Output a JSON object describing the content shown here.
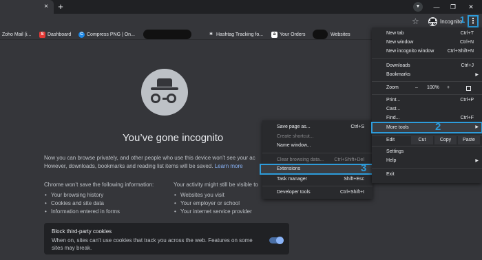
{
  "tabstrip": {
    "close_glyph": "×",
    "new_tab_glyph": "+",
    "tab_search_glyph": "▼",
    "minimize_glyph": "—",
    "restore_glyph": "❐",
    "close_window_glyph": "✕"
  },
  "toolbar": {
    "star_glyph": "☆",
    "profile_label": "Incognito",
    "menu_glyph": "⋮",
    "marker": "1"
  },
  "bookmarks": [
    {
      "label": "Zoho Mail (i...",
      "icon": "",
      "color": "#35363a"
    },
    {
      "label": "Dashboard",
      "icon": "S",
      "color": "#e53935"
    },
    {
      "label": "Compress PNG | On...",
      "icon": "C",
      "color": "#1e88e5"
    },
    {
      "label": "Hashtag Tracking fo...",
      "icon": "✱",
      "color": "#35363a"
    },
    {
      "label": "Your Orders",
      "icon": "a",
      "color": "#35363a"
    },
    {
      "label": "Websites",
      "icon": "",
      "color": "#35363a"
    }
  ],
  "page": {
    "title": "You’ve gone incognito",
    "para1": "Now you can browse privately, and other people who use this device won’t see your ac",
    "para2": "However, downloads, bookmarks and reading list items will be saved.",
    "learn_more": "Learn more",
    "col1_head": "Chrome won’t save the following information:",
    "col1_items": [
      "Your browsing history",
      "Cookies and site data",
      "Information entered in forms"
    ],
    "col2_head": "Your activity might still be visible to",
    "col2_items": [
      "Websites you visit",
      "Your employer or school",
      "Your internet service provider"
    ],
    "cookie_title": "Block third-party cookies",
    "cookie_desc": "When on, sites can’t use cookies that track you across the web. Features on some sites may break."
  },
  "main_menu": {
    "new_tab": {
      "label": "New tab",
      "shortcut": "Ctrl+T"
    },
    "new_window": {
      "label": "New window",
      "shortcut": "Ctrl+N"
    },
    "new_incognito": {
      "label": "New incognito window",
      "shortcut": "Ctrl+Shift+N"
    },
    "downloads": {
      "label": "Downloads",
      "shortcut": "Ctrl+J"
    },
    "bookmarks": {
      "label": "Bookmarks",
      "arrow": "▶"
    },
    "zoom": {
      "label": "Zoom",
      "minus": "–",
      "value": "100%",
      "plus": "+"
    },
    "print": {
      "label": "Print...",
      "shortcut": "Ctrl+P"
    },
    "cast": {
      "label": "Cast..."
    },
    "find": {
      "label": "Find...",
      "shortcut": "Ctrl+F"
    },
    "more_tools": {
      "label": "More tools",
      "arrow": "▶",
      "marker": "2"
    },
    "edit": {
      "label": "Edit",
      "cut": "Cut",
      "copy": "Copy",
      "paste": "Paste"
    },
    "settings": {
      "label": "Settings"
    },
    "help": {
      "label": "Help",
      "arrow": "▶"
    },
    "exit": {
      "label": "Exit"
    }
  },
  "submenu": {
    "save_page": {
      "label": "Save page as...",
      "shortcut": "Ctrl+S"
    },
    "create_shortcut": {
      "label": "Create shortcut..."
    },
    "name_window": {
      "label": "Name window..."
    },
    "clear_data": {
      "label": "Clear browsing data...",
      "shortcut": "Ctrl+Shift+Del"
    },
    "extensions": {
      "label": "Extensions",
      "marker": "3"
    },
    "task_manager": {
      "label": "Task manager",
      "shortcut": "Shift+Esc"
    },
    "dev_tools": {
      "label": "Developer tools",
      "shortcut": "Ctrl+Shift+I"
    }
  },
  "colors": {
    "annotation_blue": "#2d9cdb",
    "page_bg": "#35363a",
    "menu_bg": "#292a2d",
    "link": "#8ab4f8"
  }
}
